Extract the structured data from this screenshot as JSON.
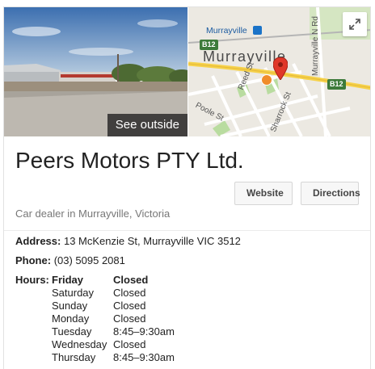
{
  "street_view": {
    "button_label": "See outside"
  },
  "map": {
    "town": "Murrayville",
    "transit_label": "Murrayville",
    "roads": [
      {
        "name": "Reed St"
      },
      {
        "name": "Poole St"
      },
      {
        "name": "Sharrock St"
      },
      {
        "name": "Murrayville N Rd"
      }
    ],
    "highway": "B12"
  },
  "business": {
    "name": "Peers Motors PTY Ltd.",
    "category": "Car dealer in Murrayville, Victoria"
  },
  "actions": {
    "website_label": "Website",
    "directions_label": "Directions"
  },
  "details": {
    "address_label": "Address:",
    "address": "13 McKenzie St, Murrayville VIC 3512",
    "phone_label": "Phone:",
    "phone": "(03) 5095 2081",
    "hours_label": "Hours:",
    "hours": [
      {
        "day": "Friday",
        "time": "Closed"
      },
      {
        "day": "Saturday",
        "time": "Closed"
      },
      {
        "day": "Sunday",
        "time": "Closed"
      },
      {
        "day": "Monday",
        "time": "Closed"
      },
      {
        "day": "Tuesday",
        "time": "8:45–9:30am"
      },
      {
        "day": "Wednesday",
        "time": "Closed"
      },
      {
        "day": "Thursday",
        "time": "8:45–9:30am"
      }
    ]
  },
  "colors": {
    "pin": "#e0382a",
    "highway_fill": "#f6d24a",
    "park_green": "#b9dca0"
  }
}
